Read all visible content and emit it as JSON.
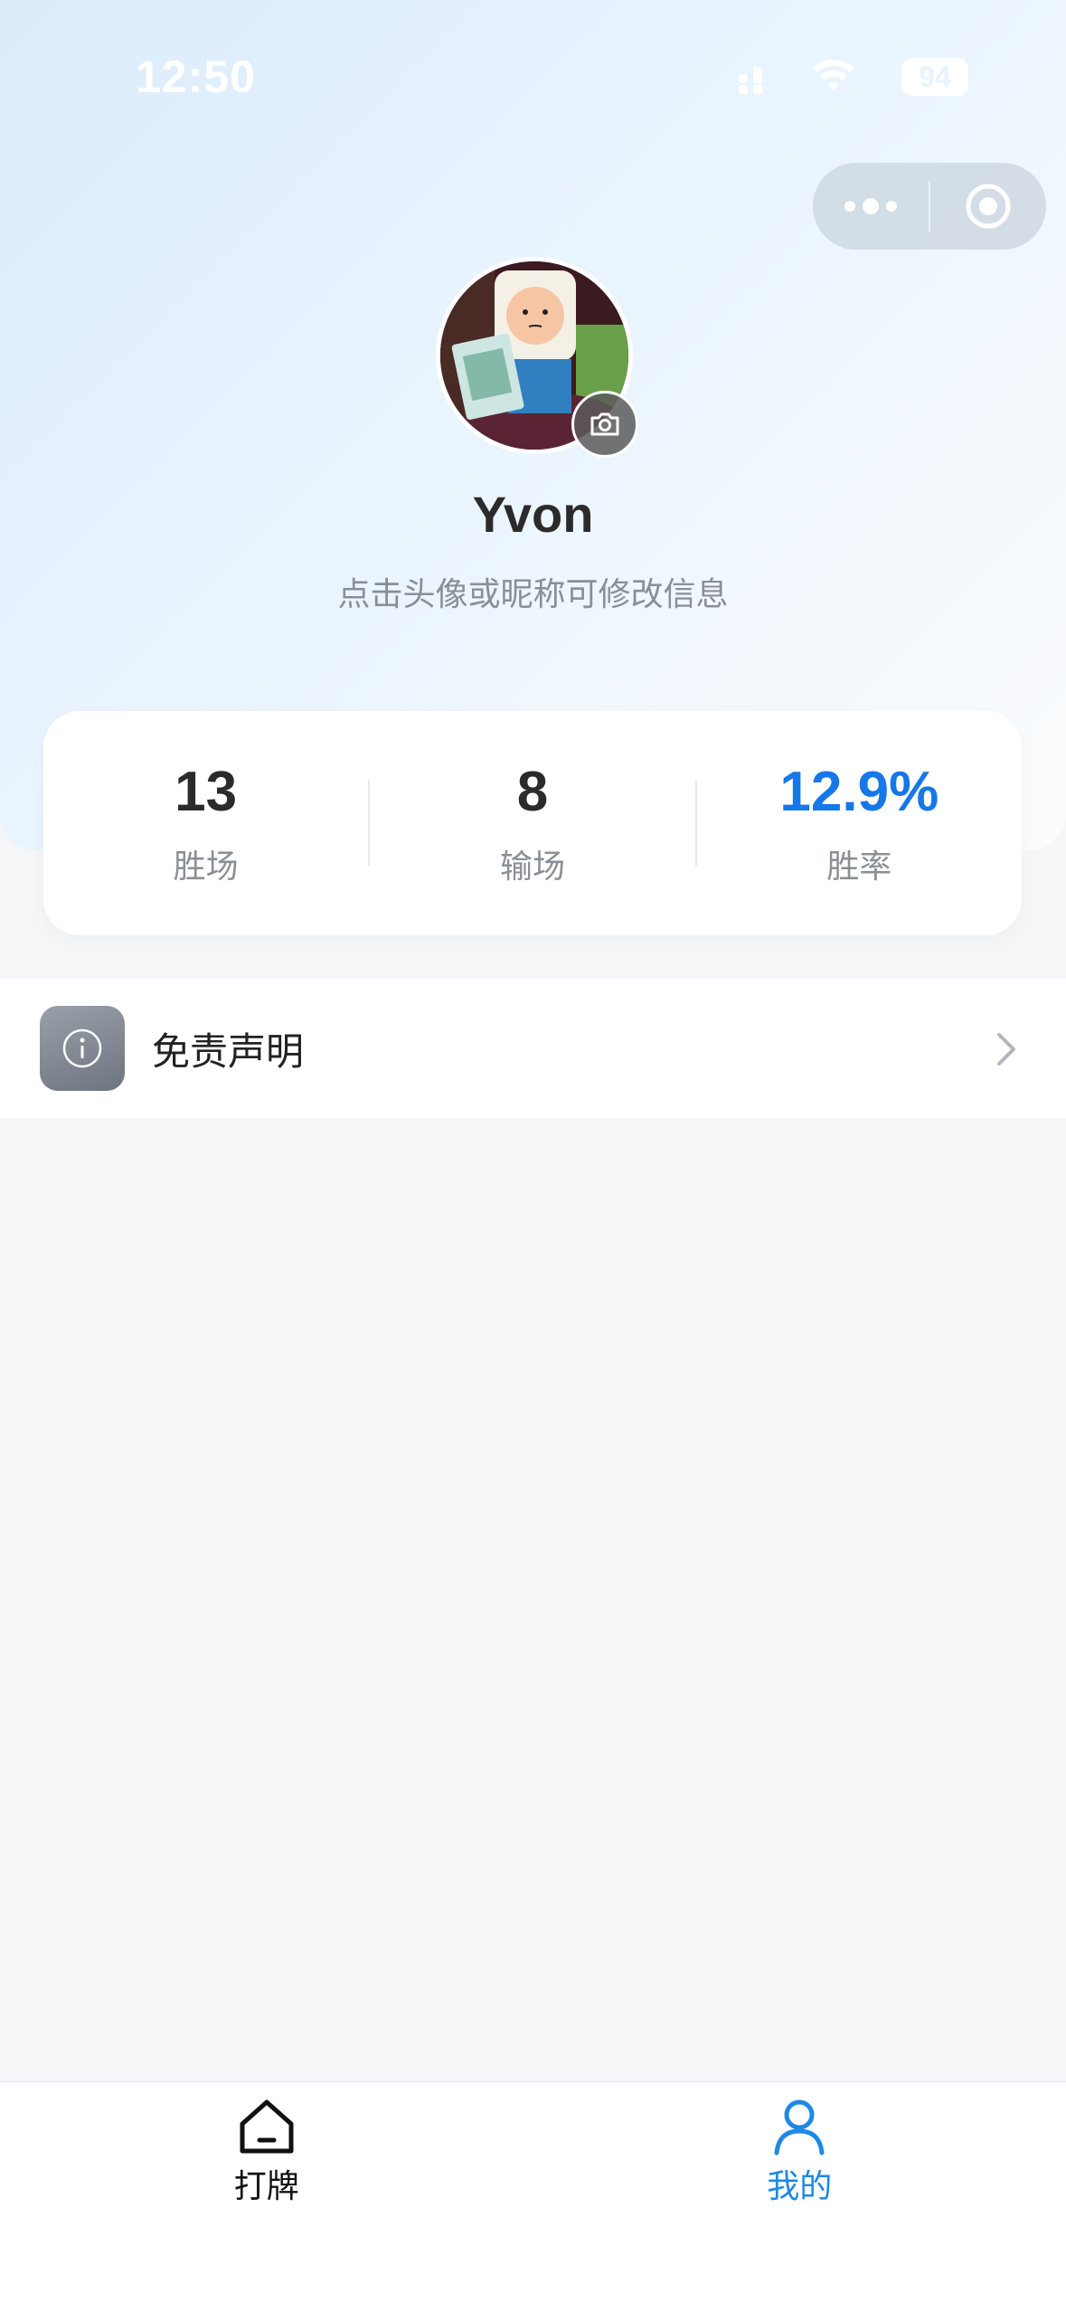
{
  "status_bar": {
    "time": "12:50",
    "battery": "94",
    "icons": [
      "signal-icon",
      "wifi-icon",
      "battery-icon"
    ]
  },
  "capsule": {
    "icons": [
      "more-icon",
      "close-target-icon"
    ]
  },
  "profile": {
    "nickname": "Yvon",
    "hint": "点击头像或昵称可修改信息",
    "avatar_icon": "camera-icon"
  },
  "stats": [
    {
      "value": "13",
      "label": "胜场"
    },
    {
      "value": "8",
      "label": "输场"
    },
    {
      "value": "12.9%",
      "label": "胜率"
    }
  ],
  "menu": {
    "items": [
      {
        "label": "免责声明",
        "icon": "info-icon"
      }
    ]
  },
  "tabbar": {
    "tabs": [
      {
        "label": "打牌",
        "icon": "home-icon",
        "active": false
      },
      {
        "label": "我的",
        "icon": "user-icon",
        "active": true
      }
    ]
  },
  "colors": {
    "accent": "#1677e8",
    "tab_active": "#1e88e5",
    "background": "#f5f6f8"
  }
}
